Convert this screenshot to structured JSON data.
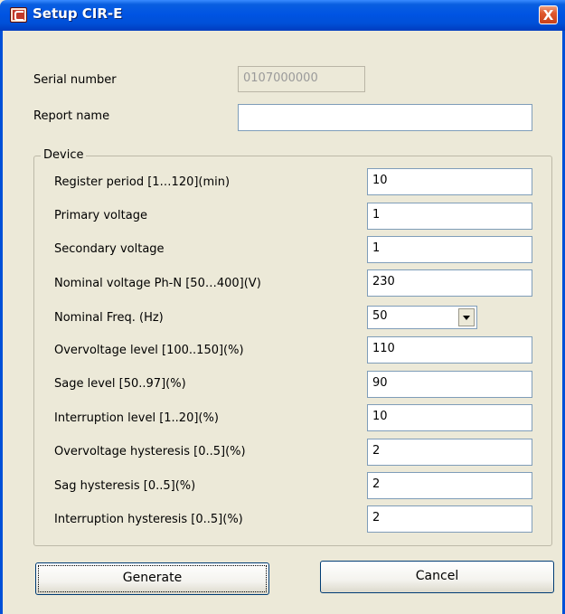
{
  "window": {
    "title": "Setup CIR-E",
    "close_label": "X"
  },
  "fields": {
    "serial_number": {
      "label": "Serial number",
      "value": "0107000000"
    },
    "report_name": {
      "label": "Report name",
      "value": ""
    }
  },
  "device": {
    "legend": "Device",
    "rows": [
      {
        "label": "Register period [1…120](min)",
        "value": "10"
      },
      {
        "label": "Primary voltage",
        "value": "1"
      },
      {
        "label": "Secondary voltage",
        "value": "1"
      },
      {
        "label": "Nominal voltage Ph-N [50…400](V)",
        "value": "230"
      },
      {
        "label": "Nominal Freq. (Hz)",
        "value": "50"
      },
      {
        "label": "Overvoltage level [100..150](%)",
        "value": "110"
      },
      {
        "label": "Sage level [50..97](%)",
        "value": "90"
      },
      {
        "label": "Interruption level [1..20](%)",
        "value": "10"
      },
      {
        "label": "Overvoltage hysteresis [0..5](%)",
        "value": "2"
      },
      {
        "label": "Sag hysteresis [0..5](%)",
        "value": "2"
      },
      {
        "label": "Interruption hysteresis [0..5](%)",
        "value": "2"
      }
    ]
  },
  "buttons": {
    "generate": "Generate",
    "cancel": "Cancel"
  },
  "colors": {
    "titlebar": "#0054e3",
    "dialog_bg": "#ece9d8",
    "close_button": "#e0582d"
  }
}
